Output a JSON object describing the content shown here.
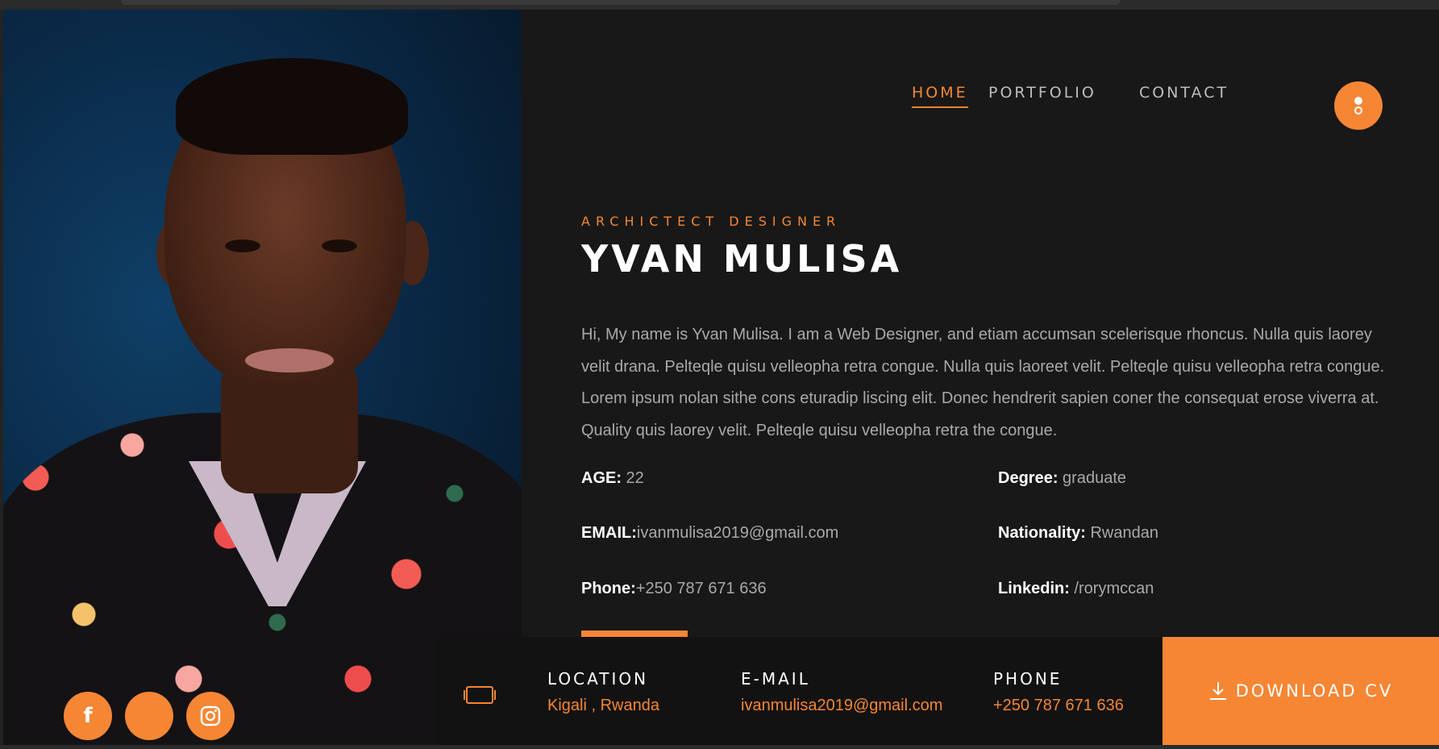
{
  "nav": {
    "home": "HOME",
    "portfolio": "PORTFOLIO",
    "contact": "CONTACT"
  },
  "hero": {
    "subtitle": "ARCHICTECT DESIGNER",
    "name": "YVAN MULISA",
    "bio": "Hi, My name is Yvan Mulisa. I am a Web Designer, and etiam accumsan scelerisque rhoncus. Nulla quis laorey velit drana. Pelteqle quisu velleopha retra congue. Nulla quis laoreet velit. Pelteqle quisu velleopha retra congue. Lorem ipsum nolan sithe cons eturadip liscing elit. Donec hendrerit sapien coner the consequat erose viverra at. Quality quis laorey velit. Pelteqle quisu velleopha retra the congue."
  },
  "info": {
    "age_label": "AGE:",
    "age_value": " 22",
    "email_label": "EMAIL:",
    "email_value": "ivanmulisa2019@gmail.com",
    "phone_label": "Phone:",
    "phone_value": "+250 787 671 636",
    "degree_label": "Degree:",
    "degree_value": " graduate",
    "nationality_label": "Nationality:",
    "nationality_value": " Rwandan",
    "linkedin_label": "Linkedin:",
    "linkedin_value": " /rorymccan"
  },
  "strip": {
    "location_label": "LOCATION",
    "location_value": "Kigali , Rwanda",
    "email_label": "E-MAIL",
    "email_value": "ivanmulisa2019@gmail.com",
    "phone_label": "PHONE",
    "phone_value": "+250 787 671 636"
  },
  "download": {
    "label": "DOWNLOAD CV"
  },
  "social": {
    "facebook_glyph": "f"
  },
  "colors": {
    "accent": "#f58634",
    "background": "#181818",
    "text_muted": "#a9a9a9"
  },
  "icons": [
    "facebook-icon",
    "twitter-icon",
    "instagram-icon",
    "menu-dots-icon",
    "tablet-icon",
    "download-icon"
  ]
}
